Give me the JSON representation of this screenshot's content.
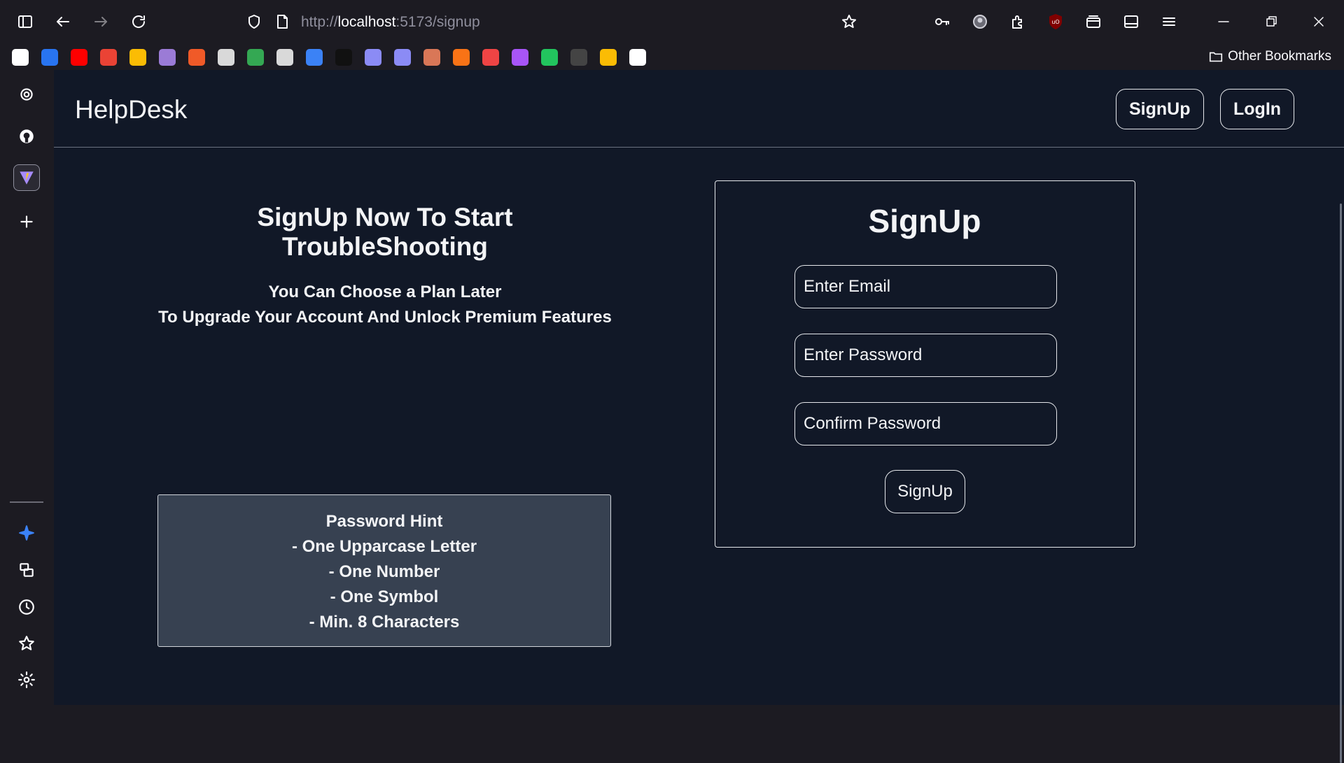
{
  "browser": {
    "url_prefix": "http://",
    "url_host": "localhost",
    "url_path": ":5173/signup",
    "other_bookmarks_label": "Other Bookmarks",
    "bookmarks": [
      {
        "name": "amazon",
        "color": "#ffffff"
      },
      {
        "name": "flipkart",
        "color": "#2874f0"
      },
      {
        "name": "youtube",
        "color": "#ff0000"
      },
      {
        "name": "gmail",
        "color": "#ea4335"
      },
      {
        "name": "keep",
        "color": "#fbbc04"
      },
      {
        "name": "orb",
        "color": "#9b7bd6"
      },
      {
        "name": "x-tool",
        "color": "#f05a28"
      },
      {
        "name": "globe",
        "color": "#d9d9d9"
      },
      {
        "name": "drive",
        "color": "#34a853"
      },
      {
        "name": "chatgpt",
        "color": "#d9d9d9"
      },
      {
        "name": "codeium",
        "color": "#3b82f6"
      },
      {
        "name": "k-app",
        "color": "#111111"
      },
      {
        "name": "linear",
        "color": "#8b8bf5"
      },
      {
        "name": "linear-2",
        "color": "#8b8bf5"
      },
      {
        "name": "claude",
        "color": "#d97757"
      },
      {
        "name": "orange-app",
        "color": "#f97316"
      },
      {
        "name": "play-app",
        "color": "#ef4444"
      },
      {
        "name": "loop",
        "color": "#a855f7"
      },
      {
        "name": "bars",
        "color": "#22c55e"
      },
      {
        "name": "github",
        "color": "#444444"
      },
      {
        "name": "photos",
        "color": "#fbbc04"
      },
      {
        "name": "ghost",
        "color": "#ffffff"
      }
    ]
  },
  "app": {
    "brand": "HelpDesk",
    "nav": {
      "signup_label": "SignUp",
      "login_label": "LogIn"
    },
    "headline": "SignUp Now To Start TroubleShooting",
    "subtext_line1": "You Can Choose a Plan Later",
    "subtext_line2": "To Upgrade Your Account And Unlock Premium Features",
    "hint": {
      "title": "Password Hint",
      "items": [
        "- One Upparcase Letter",
        "- One Number",
        "- One Symbol",
        "- Min. 8 Characters"
      ]
    },
    "form": {
      "title": "SignUp",
      "email_placeholder": "Enter Email",
      "password_placeholder": "Enter Password",
      "confirm_placeholder": "Confirm Password",
      "submit_label": "SignUp"
    }
  }
}
